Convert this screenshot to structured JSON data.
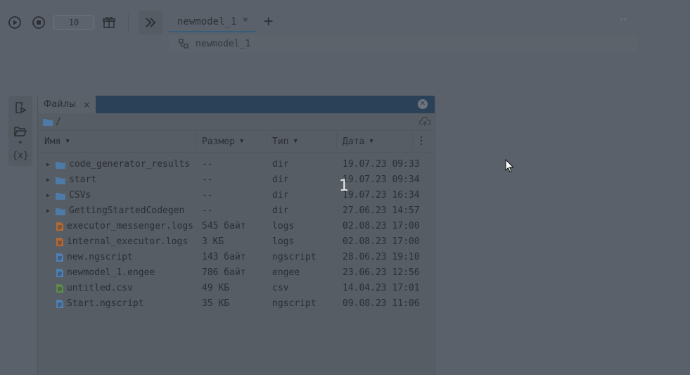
{
  "toolbar": {
    "steps_value": "10",
    "icons": [
      "play-icon",
      "stop-icon",
      "gift-icon",
      "double-chevron-icon"
    ]
  },
  "tabs": [
    {
      "label": "newmodel_1 *"
    }
  ],
  "breadcrumb": {
    "label": "newmodel_1"
  },
  "sidebar": {
    "icons": [
      "run-script-icon",
      "folder-open-icon",
      "variables-icon"
    ],
    "variables_label": "{x}"
  },
  "files_panel": {
    "tab_label": "Файлы",
    "tab_close": "×",
    "path": "/",
    "columns": {
      "name": "Имя",
      "size": "Размер",
      "type": "Тип",
      "date": "Дата"
    },
    "rows": [
      {
        "name": "code_generator_results",
        "size": "--",
        "type": "dir",
        "date": "19.07.23 09:33",
        "kind": "folder"
      },
      {
        "name": "start",
        "size": "--",
        "type": "dir",
        "date": "19.07.23 09:34",
        "kind": "folder"
      },
      {
        "name": "CSVs",
        "size": "--",
        "type": "dir",
        "date": "19.07.23 16:34",
        "kind": "folder"
      },
      {
        "name": "GettingStartedCodegen",
        "size": "--",
        "type": "dir",
        "date": "27.06.23 14:57",
        "kind": "folder"
      },
      {
        "name": "executor_messenger.logs",
        "size": "545 байт",
        "type": "logs",
        "date": "02.08.23 17:00",
        "kind": "log"
      },
      {
        "name": "internal_executor.logs",
        "size": "3 КБ",
        "type": "logs",
        "date": "02.08.23 17:00",
        "kind": "log"
      },
      {
        "name": "new.ngscript",
        "size": "143 байт",
        "type": "ngscript",
        "date": "28.06.23 19:10",
        "kind": "script"
      },
      {
        "name": "newmodel_1.engee",
        "size": "786 байт",
        "type": "engee",
        "date": "23.06.23 12:56",
        "kind": "script"
      },
      {
        "name": "untitled.csv",
        "size": "49 КБ",
        "type": "csv",
        "date": "14.04.23 17:01",
        "kind": "csv"
      },
      {
        "name": "Start.ngscript",
        "size": "35 КБ",
        "type": "ngscript",
        "date": "09.08.23 11:06",
        "kind": "script"
      }
    ]
  },
  "overlay": {
    "step_number": "1"
  },
  "colors": {
    "background": "#5b616a",
    "panel_header": "#2b4157",
    "folder": "#4d7aa6",
    "log_file": "#b06a38",
    "script_file": "#4f7fb3",
    "csv_file": "#5f8a4e"
  }
}
